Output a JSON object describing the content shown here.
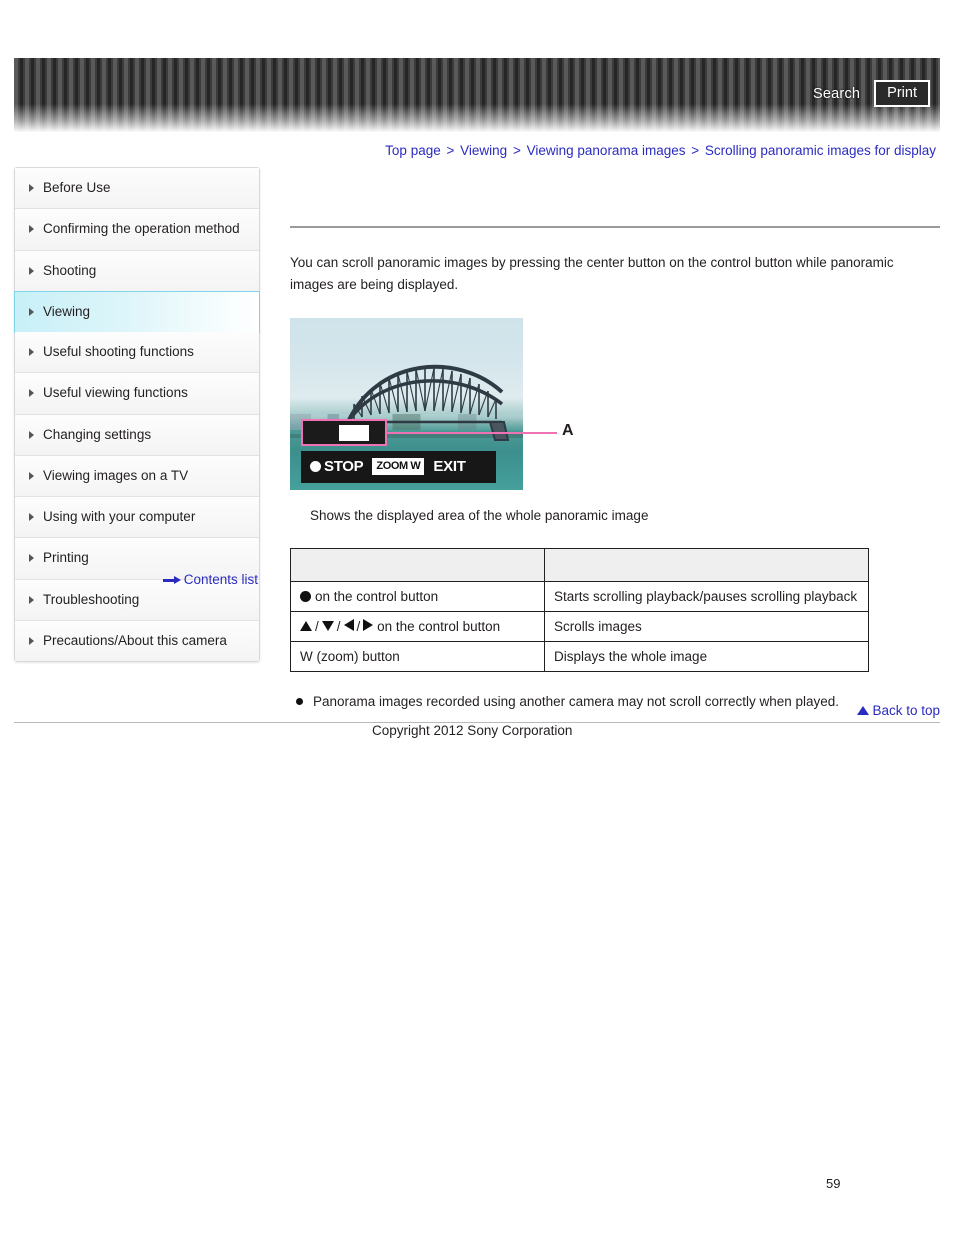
{
  "header": {
    "search_label": "Search",
    "print_label": "Print"
  },
  "breadcrumb": {
    "separator": ">",
    "items": [
      {
        "label": "Top page"
      },
      {
        "label": "Viewing"
      },
      {
        "label": "Viewing panorama images"
      },
      {
        "label": "Scrolling panoramic images for display"
      }
    ]
  },
  "sidebar": {
    "items": [
      {
        "label": "Before Use",
        "active": false
      },
      {
        "label": "Confirming the operation method",
        "active": false
      },
      {
        "label": "Shooting",
        "active": false
      },
      {
        "label": "Viewing",
        "active": true
      },
      {
        "label": "Useful shooting functions",
        "active": false
      },
      {
        "label": "Useful viewing functions",
        "active": false
      },
      {
        "label": "Changing settings",
        "active": false
      },
      {
        "label": "Viewing images on a TV",
        "active": false
      },
      {
        "label": "Using with your computer",
        "active": false
      },
      {
        "label": "Printing",
        "active": false
      },
      {
        "label": "Troubleshooting",
        "active": false
      },
      {
        "label": "Precautions/About this camera",
        "active": false
      }
    ],
    "contents_list_label": "Contents list"
  },
  "main": {
    "intro": "You can scroll panoramic images by pressing the center button on the control button while panoramic images are being displayed.",
    "figure": {
      "osd_stop_label": "STOP",
      "osd_zoom_label": "ZOOM W",
      "osd_exit_label": "EXIT",
      "callout_label": "A",
      "caption": "Shows the displayed area of the whole panoramic image"
    },
    "table": {
      "headers": [
        "",
        ""
      ],
      "rows": [
        {
          "operation": "on the control button",
          "result": "Starts scrolling playback/pauses scrolling playback",
          "icon": "circle-button-icon"
        },
        {
          "operation": "on the control button",
          "result": "Scrolls images",
          "icon": "direction-pad-icons"
        },
        {
          "operation": "W (zoom) button",
          "result": "Displays the whole image",
          "icon": "none"
        }
      ],
      "separator": "/"
    },
    "note": "Panorama images recorded using another camera may not scroll correctly when played."
  },
  "footer": {
    "back_to_top_label": "Back to top",
    "copyright": "Copyright 2012 Sony Corporation",
    "page_number": "59"
  },
  "colors": {
    "link": "#2b2bc0",
    "active_nav": "#7fd4e8",
    "callout_pink": "#ef72b4",
    "header_dark": "#3c3c3c"
  }
}
